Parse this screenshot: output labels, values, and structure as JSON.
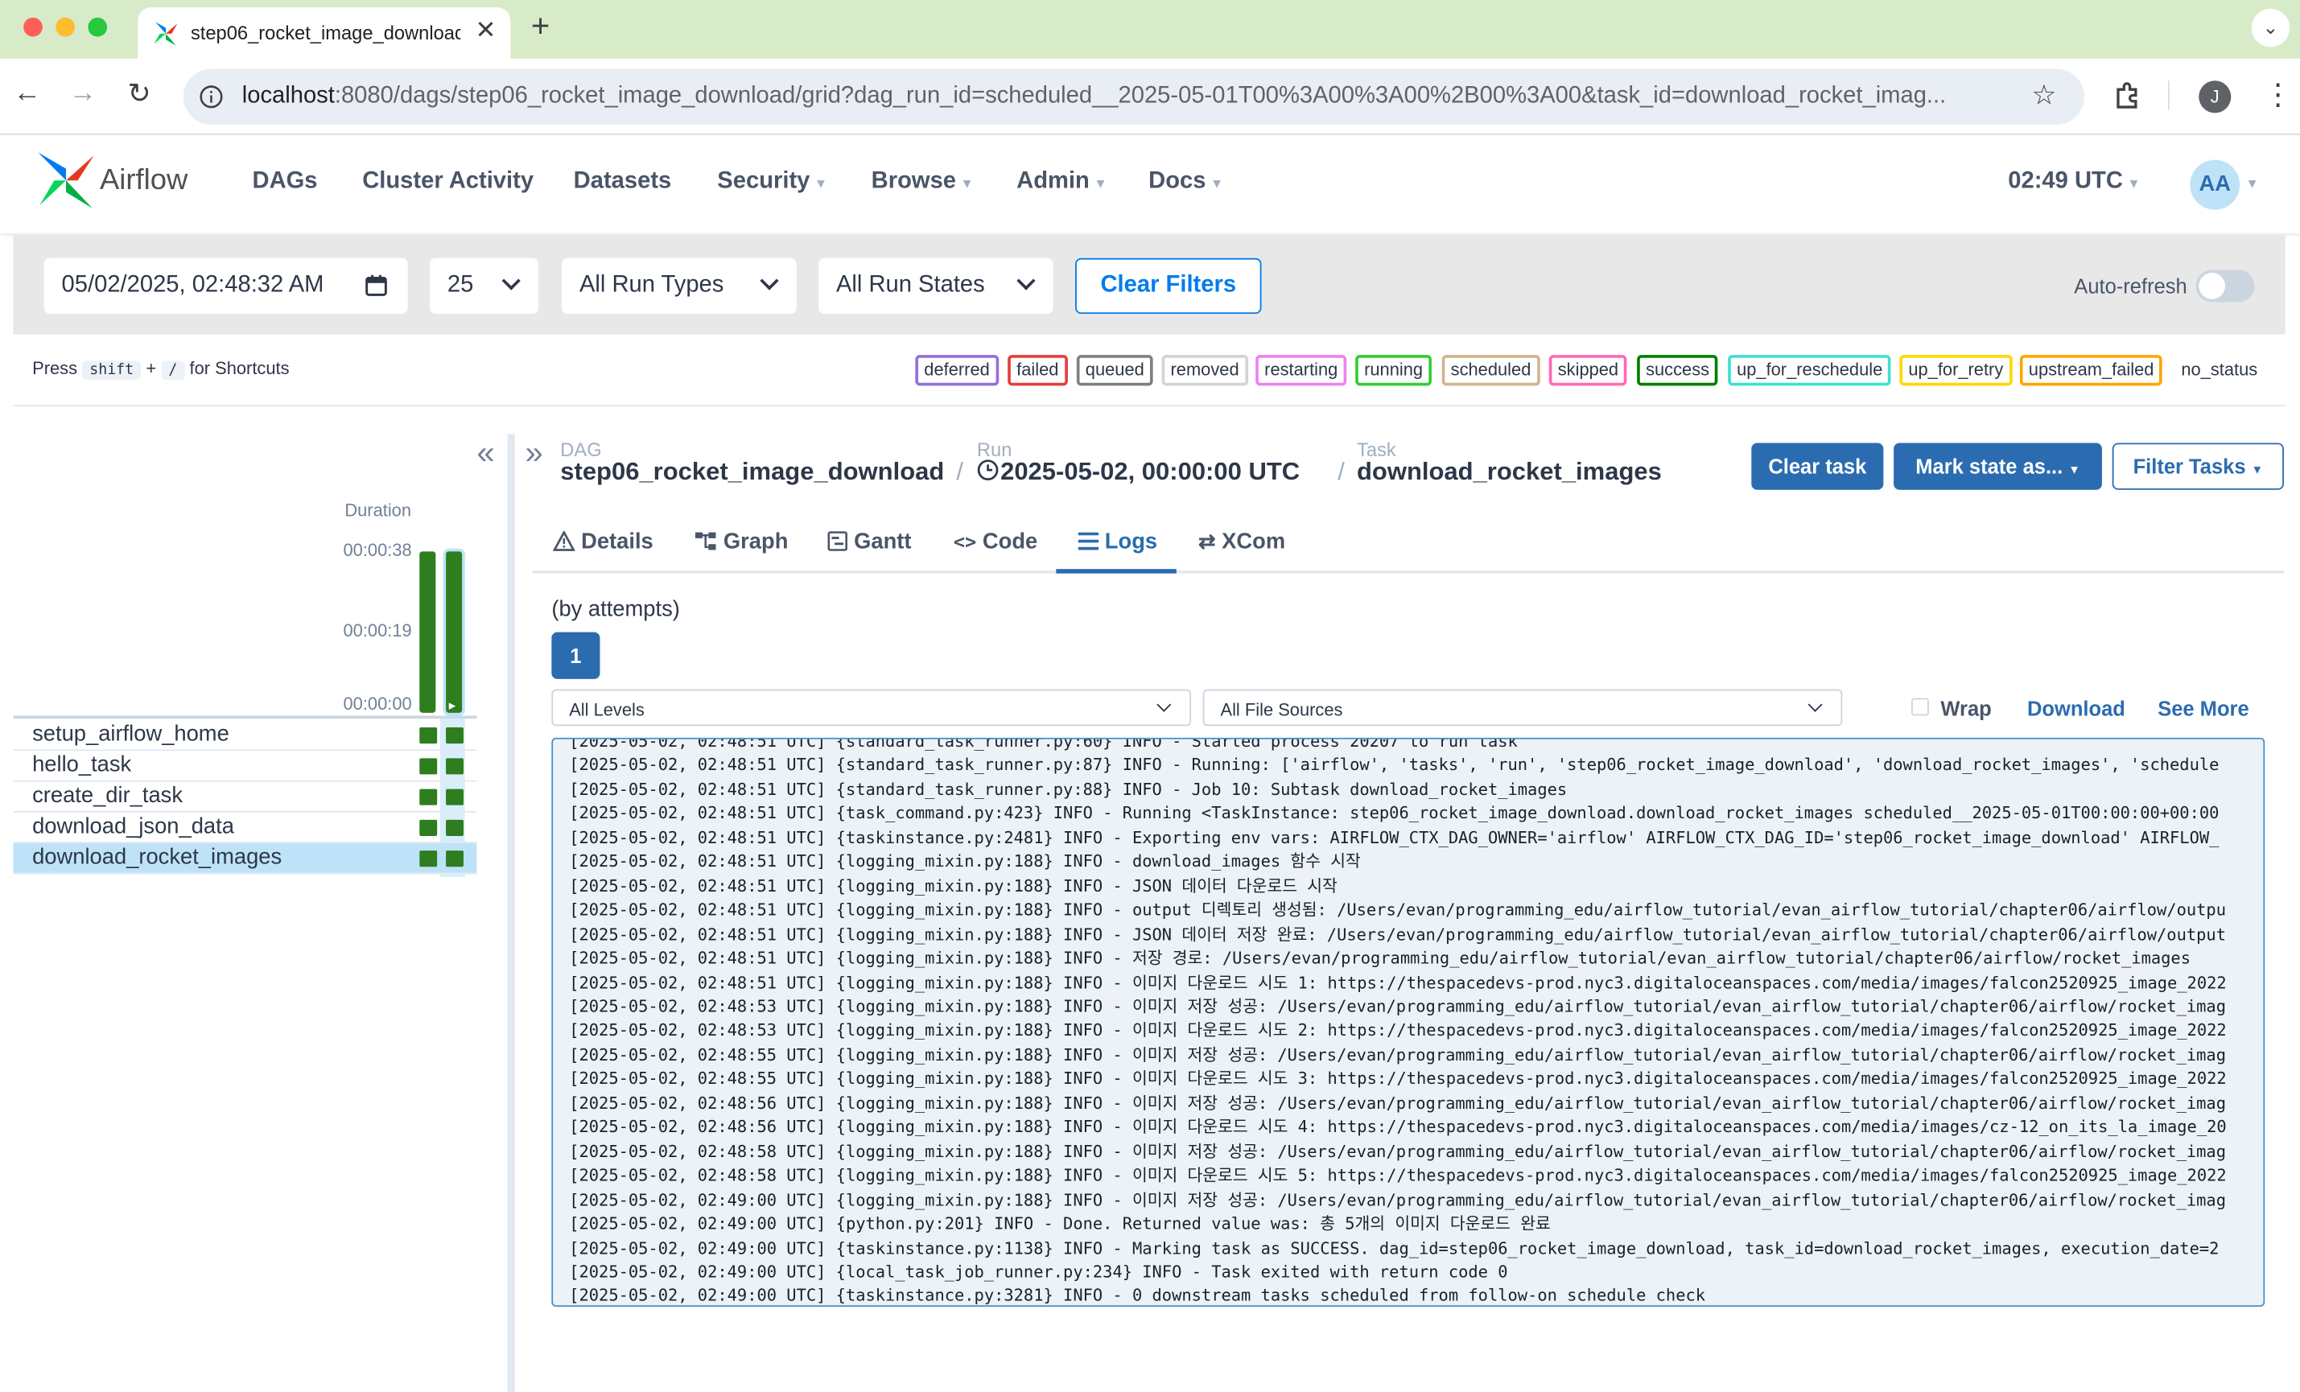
{
  "browser": {
    "tab_title": "step06_rocket_image_download",
    "url_host": "localhost",
    "url_rest": ":8080/dags/step06_rocket_image_download/grid?dag_run_id=scheduled__2025-05-01T00%3A00%3A00%2B00%3A00&task_id=download_rocket_imag...",
    "profile_initial": "J"
  },
  "nav": {
    "brand": "Airflow",
    "items": [
      "DAGs",
      "Cluster Activity",
      "Datasets",
      "Security",
      "Browse",
      "Admin",
      "Docs"
    ],
    "time": "02:49 UTC",
    "avatar": "AA"
  },
  "filters": {
    "date": "05/02/2025, 02:48:32  AM",
    "num_runs": "25",
    "run_types": "All Run Types",
    "run_states": "All Run States",
    "clear_label": "Clear Filters",
    "auto_refresh": "Auto-refresh"
  },
  "shortcuts": {
    "press": "Press",
    "key1": "shift",
    "plus": "+",
    "key2": "/",
    "suffix": "for Shortcuts"
  },
  "legend": [
    {
      "label": "deferred",
      "color": "#9370db"
    },
    {
      "label": "failed",
      "color": "#e53e3e"
    },
    {
      "label": "queued",
      "color": "#808080"
    },
    {
      "label": "removed",
      "color": "#d3d3d3"
    },
    {
      "label": "restarting",
      "color": "#ee82ee"
    },
    {
      "label": "running",
      "color": "#32cd32"
    },
    {
      "label": "scheduled",
      "color": "#d2b48c"
    },
    {
      "label": "skipped",
      "color": "#ff69b4"
    },
    {
      "label": "success",
      "color": "#008000"
    },
    {
      "label": "up_for_reschedule",
      "color": "#40e0d0"
    },
    {
      "label": "up_for_retry",
      "color": "#ffd700"
    },
    {
      "label": "upstream_failed",
      "color": "#ffa500"
    },
    {
      "label": "no_status",
      "color": "none"
    }
  ],
  "grid": {
    "duration_label": "Duration",
    "ticks": [
      "00:00:38",
      "00:00:19",
      "00:00:00"
    ],
    "runs": [
      {
        "duration_fraction": 1.0
      },
      {
        "duration_fraction": 1.0
      }
    ],
    "tasks": [
      "setup_airflow_home",
      "hello_task",
      "create_dir_task",
      "download_json_data",
      "download_rocket_images"
    ],
    "selected_task": "download_rocket_images"
  },
  "breadcrumb": {
    "dag_label": "DAG",
    "dag": "step06_rocket_image_download",
    "run_label": "Run",
    "run": "2025-05-02, 00:00:00 UTC",
    "task_label": "Task",
    "task": "download_rocket_images"
  },
  "actions": {
    "clear_task": "Clear task",
    "mark_state": "Mark state as...",
    "filter_tasks": "Filter Tasks"
  },
  "tabs": [
    "Details",
    "Graph",
    "Gantt",
    "Code",
    "Logs",
    "XCom"
  ],
  "active_tab": "Logs",
  "logs": {
    "attempts_label": "(by attempts)",
    "attempt": "1",
    "levels": "All Levels",
    "sources": "All File Sources",
    "wrap": "Wrap",
    "download": "Download",
    "see_more": "See More",
    "lines": [
      "[2025-05-02, 02:48:51 UTC] {standard_task_runner.py:60} INFO - Started process 20207 to run task",
      "[2025-05-02, 02:48:51 UTC] {standard_task_runner.py:87} INFO - Running: ['airflow', 'tasks', 'run', 'step06_rocket_image_download', 'download_rocket_images', 'schedule",
      "[2025-05-02, 02:48:51 UTC] {standard_task_runner.py:88} INFO - Job 10: Subtask download_rocket_images",
      "[2025-05-02, 02:48:51 UTC] {task_command.py:423} INFO - Running <TaskInstance: step06_rocket_image_download.download_rocket_images scheduled__2025-05-01T00:00:00+00:00",
      "[2025-05-02, 02:48:51 UTC] {taskinstance.py:2481} INFO - Exporting env vars: AIRFLOW_CTX_DAG_OWNER='airflow' AIRFLOW_CTX_DAG_ID='step06_rocket_image_download' AIRFLOW_",
      "[2025-05-02, 02:48:51 UTC] {logging_mixin.py:188} INFO - download_images 함수 시작",
      "[2025-05-02, 02:48:51 UTC] {logging_mixin.py:188} INFO - JSON 데이터 다운로드 시작",
      "[2025-05-02, 02:48:51 UTC] {logging_mixin.py:188} INFO - output 디렉토리 생성됨: /Users/evan/programming_edu/airflow_tutorial/evan_airflow_tutorial/chapter06/airflow/outpu",
      "[2025-05-02, 02:48:51 UTC] {logging_mixin.py:188} INFO - JSON 데이터 저장 완료: /Users/evan/programming_edu/airflow_tutorial/evan_airflow_tutorial/chapter06/airflow/output",
      "[2025-05-02, 02:48:51 UTC] {logging_mixin.py:188} INFO - 저장 경로: /Users/evan/programming_edu/airflow_tutorial/evan_airflow_tutorial/chapter06/airflow/rocket_images",
      "[2025-05-02, 02:48:51 UTC] {logging_mixin.py:188} INFO - 이미지 다운로드 시도 1: https://thespacedevs-prod.nyc3.digitaloceanspaces.com/media/images/falcon2520925_image_2022",
      "[2025-05-02, 02:48:53 UTC] {logging_mixin.py:188} INFO - 이미지 저장 성공: /Users/evan/programming_edu/airflow_tutorial/evan_airflow_tutorial/chapter06/airflow/rocket_imag",
      "[2025-05-02, 02:48:53 UTC] {logging_mixin.py:188} INFO - 이미지 다운로드 시도 2: https://thespacedevs-prod.nyc3.digitaloceanspaces.com/media/images/falcon2520925_image_2022",
      "[2025-05-02, 02:48:55 UTC] {logging_mixin.py:188} INFO - 이미지 저장 성공: /Users/evan/programming_edu/airflow_tutorial/evan_airflow_tutorial/chapter06/airflow/rocket_imag",
      "[2025-05-02, 02:48:55 UTC] {logging_mixin.py:188} INFO - 이미지 다운로드 시도 3: https://thespacedevs-prod.nyc3.digitaloceanspaces.com/media/images/falcon2520925_image_2022",
      "[2025-05-02, 02:48:56 UTC] {logging_mixin.py:188} INFO - 이미지 저장 성공: /Users/evan/programming_edu/airflow_tutorial/evan_airflow_tutorial/chapter06/airflow/rocket_imag",
      "[2025-05-02, 02:48:56 UTC] {logging_mixin.py:188} INFO - 이미지 다운로드 시도 4: https://thespacedevs-prod.nyc3.digitaloceanspaces.com/media/images/cz-12_on_its_la_image_20",
      "[2025-05-02, 02:48:58 UTC] {logging_mixin.py:188} INFO - 이미지 저장 성공: /Users/evan/programming_edu/airflow_tutorial/evan_airflow_tutorial/chapter06/airflow/rocket_imag",
      "[2025-05-02, 02:48:58 UTC] {logging_mixin.py:188} INFO - 이미지 다운로드 시도 5: https://thespacedevs-prod.nyc3.digitaloceanspaces.com/media/images/falcon2520925_image_2022",
      "[2025-05-02, 02:49:00 UTC] {logging_mixin.py:188} INFO - 이미지 저장 성공: /Users/evan/programming_edu/airflow_tutorial/evan_airflow_tutorial/chapter06/airflow/rocket_imag",
      "[2025-05-02, 02:49:00 UTC] {python.py:201} INFO - Done. Returned value was: 총 5개의 이미지 다운로드 완료",
      "[2025-05-02, 02:49:00 UTC] {taskinstance.py:1138} INFO - Marking task as SUCCESS. dag_id=step06_rocket_image_download, task_id=download_rocket_images, execution_date=2",
      "[2025-05-02, 02:49:00 UTC] {local_task_job_runner.py:234} INFO - Task exited with return code 0",
      "[2025-05-02, 02:49:00 UTC] {taskinstance.py:3281} INFO - 0 downstream tasks scheduled from follow-on schedule check"
    ]
  },
  "colors": {
    "primary": "#017cee",
    "success": "#2e7d1e",
    "selected_row": "#bee3f8"
  }
}
